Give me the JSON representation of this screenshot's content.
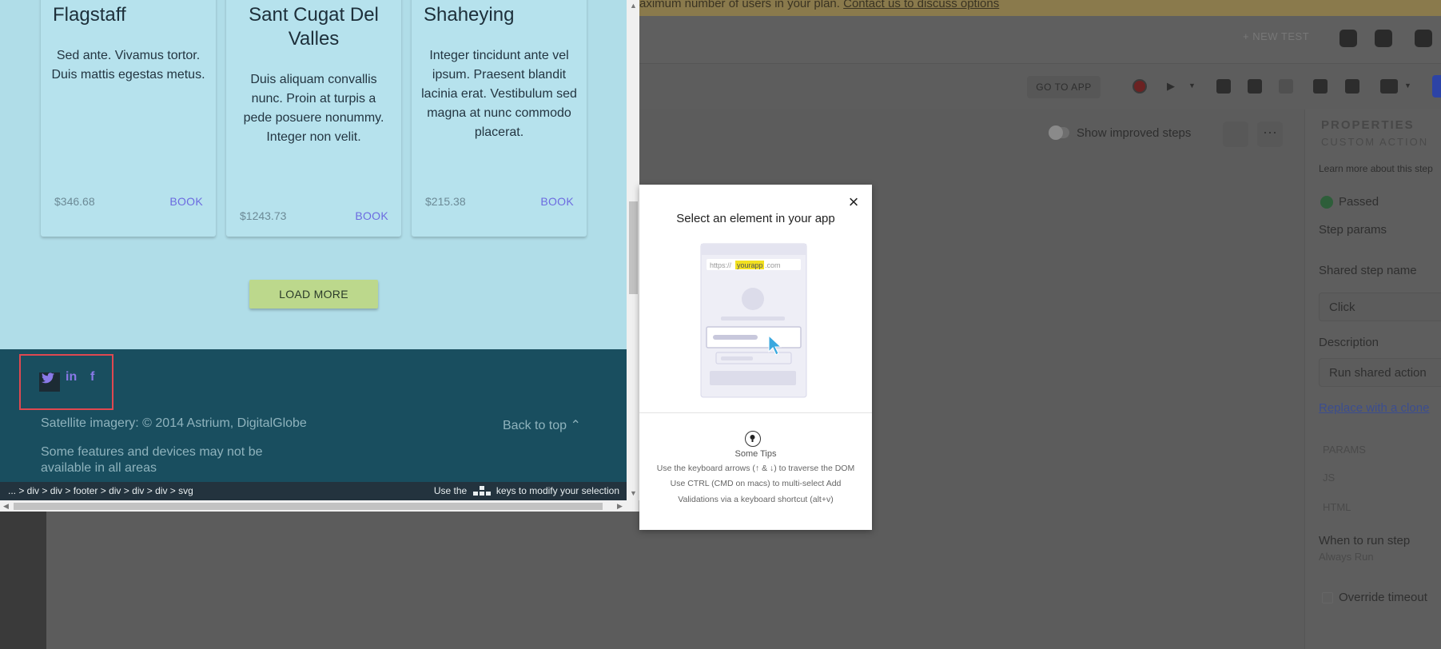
{
  "background_app": {
    "banner_text": "aximum number of users in your plan.",
    "banner_link": "Contact us to discuss options",
    "new_test_label": "+ NEW TEST",
    "go_to_app_label": "GO TO APP",
    "show_improved_steps_label": "Show improved steps",
    "properties": {
      "title": "PROPERTIES",
      "subtitle": "CUSTOM ACTION",
      "learn_more": "Learn more about this step",
      "status": "Passed",
      "step_params_label": "Step params",
      "shared_step_name_label": "Shared step name",
      "shared_step_name_value": "Click",
      "description_label": "Description",
      "description_value": "Run shared action",
      "replace_link": "Replace with a clone",
      "params_label": "PARAMS",
      "js_label": "JS",
      "html_label": "HTML",
      "when_to_run_label": "When to run step",
      "when_to_run_value": "Always Run",
      "override_timeout_label": "Override timeout"
    }
  },
  "site": {
    "cards": [
      {
        "title": "Flagstaff",
        "description": "Sed ante. Vivamus tortor. Duis mattis egestas metus.",
        "price": "$346.68",
        "action": "BOOK"
      },
      {
        "title": "Sant Cugat Del Valles",
        "description": "Duis aliquam convallis nunc. Proin at turpis a pede posuere nonummy. Integer non velit.",
        "price": "$1243.73",
        "action": "BOOK"
      },
      {
        "title": "Shaheying",
        "description": "Integer tincidunt ante vel ipsum. Praesent blandit lacinia erat. Vestibulum sed magna at nunc commodo placerat.",
        "price": "$215.38",
        "action": "BOOK"
      }
    ],
    "load_more_label": "LOAD MORE",
    "footer": {
      "social_icons": [
        "twitter-icon",
        "linkedin-icon",
        "facebook-icon"
      ],
      "copyright": "Satellite imagery: © 2014 Astrium, DigitalGlobe",
      "disclaimer_line1": "Some features and devices may not be",
      "disclaimer_line2": "available in all areas",
      "back_to_top": "Back to top"
    }
  },
  "selector_bar": {
    "path": "... > div > div > footer > div > div > div > svg",
    "hint_prefix": "Use the",
    "hint_suffix": "keys to modify your selection"
  },
  "modal": {
    "title": "Select an element in your app",
    "url_prefix": "https://",
    "url_highlight": "yourapp",
    "url_suffix": ".com",
    "tips_title": "Some Tips",
    "tip1": "Use the keyboard arrows (↑ & ↓) to traverse the DOM",
    "tip2": "Use CTRL (CMD on macs) to multi-select Add",
    "tip3": "Validations via a keyboard shortcut (alt+v)"
  },
  "colors": {
    "highlight_box": "#e04850",
    "footer_bg": "#194e5f",
    "site_bg": "#b0dde8",
    "url_highlight": "#f2e020"
  }
}
